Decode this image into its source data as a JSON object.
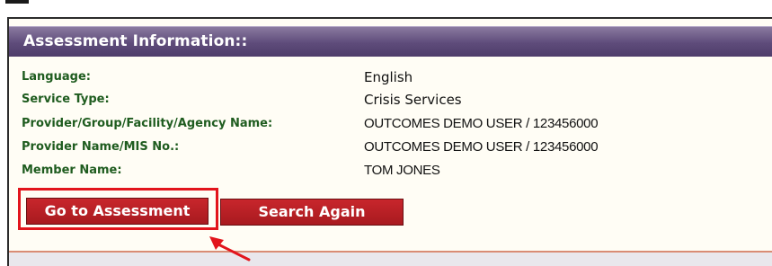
{
  "panel": {
    "title": "Assessment Information::"
  },
  "fields": [
    {
      "label": "Language:",
      "value": "English"
    },
    {
      "label": "Service Type:",
      "value": "Crisis Services"
    },
    {
      "label": "Provider/Group/Facility/Agency Name:",
      "value": "OUTCOMES DEMO USER / 123456000"
    },
    {
      "label": "Provider Name/MIS No.:",
      "value": "OUTCOMES DEMO USER / 123456000"
    },
    {
      "label": "Member Name:",
      "value": "TOM JONES"
    }
  ],
  "buttons": {
    "go_to_assessment": "Go to Assessment",
    "search_again": "Search Again"
  },
  "colors": {
    "header": "#5e4b7a",
    "label": "#1f5c1f",
    "button": "#b8202a",
    "highlight": "#e2141c",
    "divider": "#d98c74"
  }
}
